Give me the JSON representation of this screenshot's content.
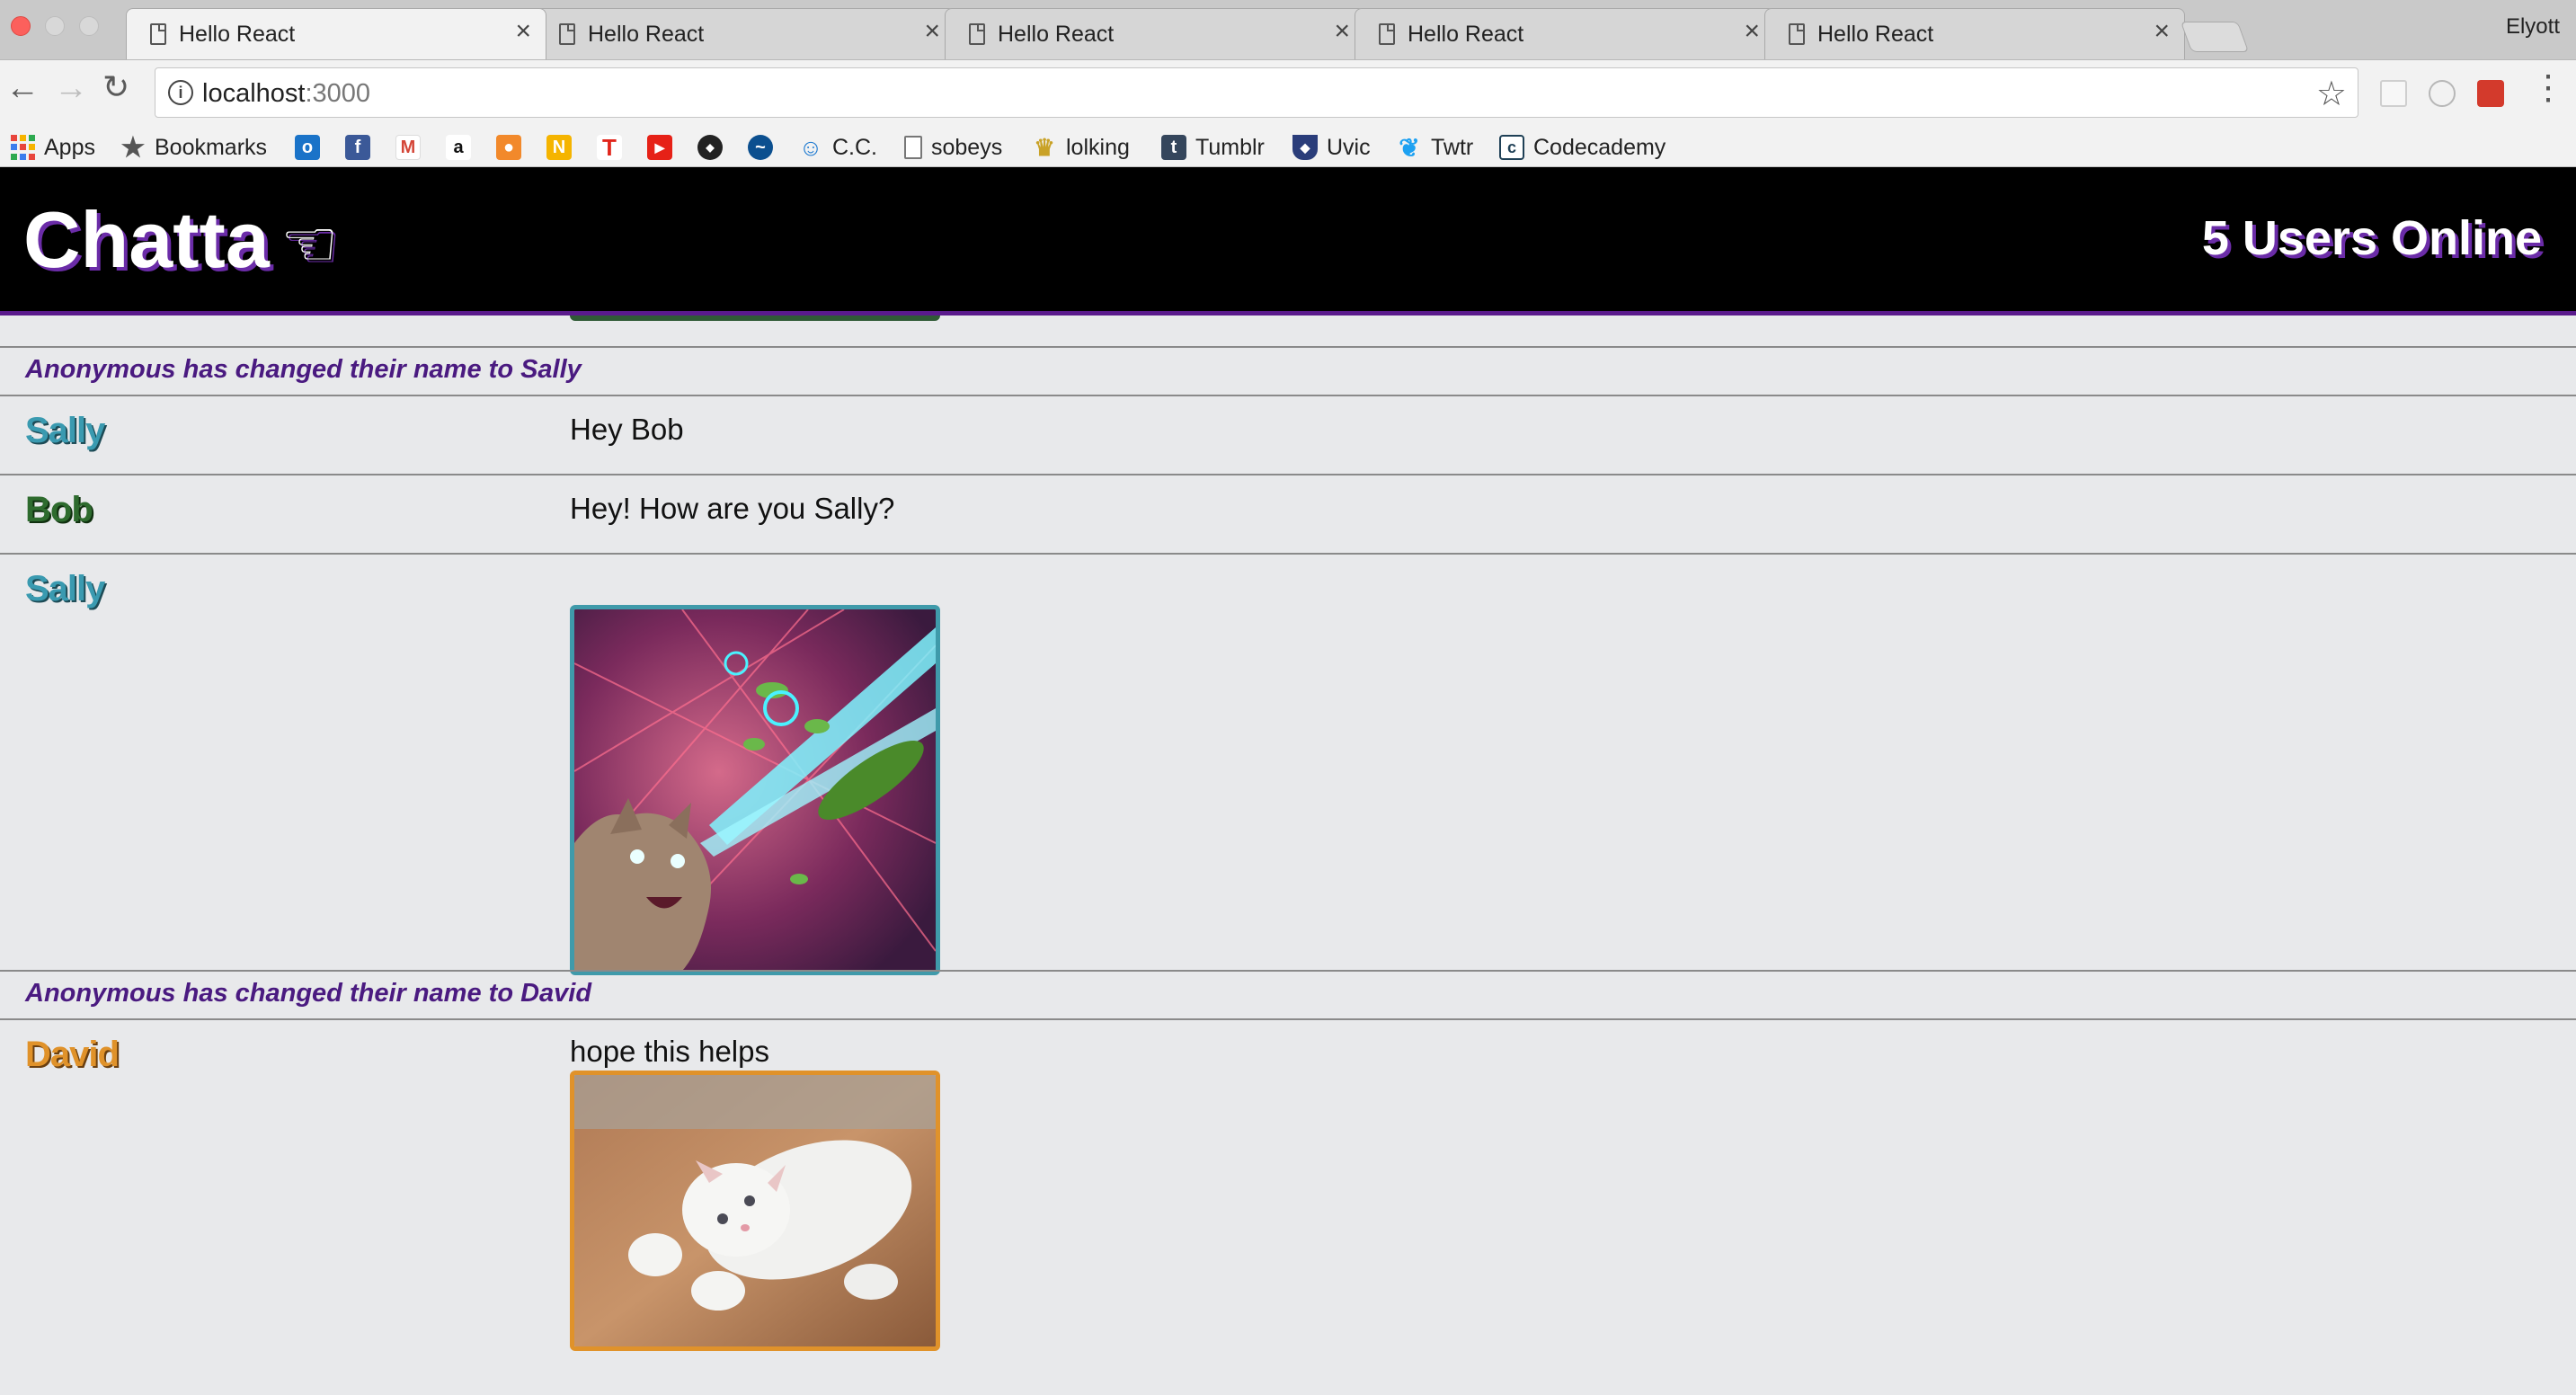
{
  "browser": {
    "tabs": [
      {
        "title": "Hello React"
      },
      {
        "title": "Hello React"
      },
      {
        "title": "Hello React"
      },
      {
        "title": "Hello React"
      },
      {
        "title": "Hello React"
      }
    ],
    "tab_close_glyph": "×",
    "profile_name": "Elyott",
    "url_host": "localhost",
    "url_port": ":3000",
    "bookmarks": [
      {
        "label": "Apps",
        "icon": "apps-grid-icon"
      },
      {
        "label": "Bookmarks",
        "icon": "star-icon"
      },
      {
        "label": "",
        "icon": "outlook-icon"
      },
      {
        "label": "",
        "icon": "facebook-icon"
      },
      {
        "label": "",
        "icon": "gmail-icon"
      },
      {
        "label": "",
        "icon": "amazon-icon"
      },
      {
        "label": "",
        "icon": "orange-app-icon"
      },
      {
        "label": "",
        "icon": "n-icon"
      },
      {
        "label": "",
        "icon": "t-icon"
      },
      {
        "label": "",
        "icon": "youtube-icon"
      },
      {
        "label": "",
        "icon": "nhl-icon"
      },
      {
        "label": "",
        "icon": "team-logo-icon"
      },
      {
        "label": "C.C.",
        "icon": "person-icon"
      },
      {
        "label": "sobeys",
        "icon": "page-icon"
      },
      {
        "label": "lolking",
        "icon": "crown-icon"
      },
      {
        "label": "Tumblr",
        "icon": "tumblr-icon"
      },
      {
        "label": "Uvic",
        "icon": "uvic-shield-icon"
      },
      {
        "label": "Twtr",
        "icon": "twitter-icon"
      },
      {
        "label": "Codecademy",
        "icon": "codecademy-icon"
      }
    ]
  },
  "app": {
    "title": "Chatta",
    "hand_glyph": "☜",
    "users_online": "5 Users Online"
  },
  "chat": {
    "notice_1": "Anonymous has changed their name to Sally",
    "msg_1": {
      "user": "Sally",
      "text": "Hey Bob"
    },
    "msg_2": {
      "user": "Bob",
      "text": "Hey! How are you Sally?"
    },
    "msg_3": {
      "user": "Sally",
      "text": "",
      "image": "laser-eye cat gif"
    },
    "notice_2": "Anonymous has changed their name to David",
    "msg_4": {
      "user": "David",
      "text": "hope this helps",
      "image": "white kitten gif"
    }
  },
  "colors": {
    "sally": "#3a9ab0",
    "bob": "#2e6b2e",
    "david": "#e0922a",
    "notice": "#4a1a80",
    "header_bg": "#000000",
    "header_shadow": "#6b2ca8"
  }
}
